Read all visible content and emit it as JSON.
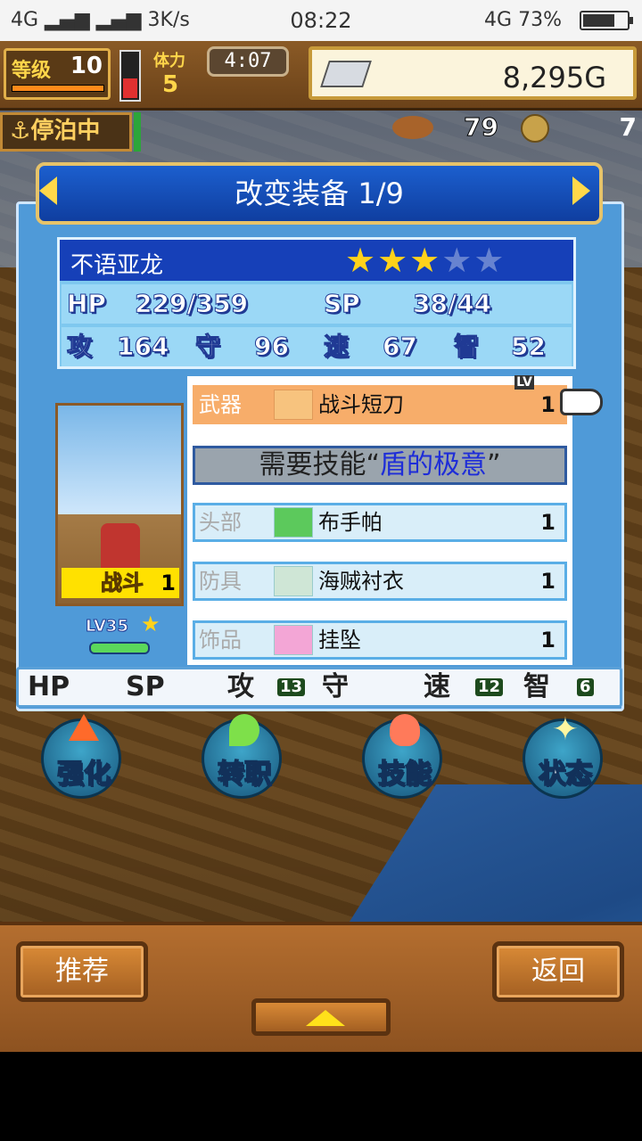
{
  "status_bar": {
    "network": "4G",
    "speed": "3K/s",
    "time": "08:22",
    "battery_network": "4G",
    "battery_pct": "73%",
    "battery_level": 0.73
  },
  "hud": {
    "level_label": "等级",
    "level_value": "10",
    "stamina_label": "体力",
    "stamina_value": "5",
    "timer": "4:07",
    "gold": "8,295G",
    "moored_label": "停泊中",
    "res_a": "79",
    "res_b": "7"
  },
  "panel": {
    "title": "改变装备 1/9",
    "character": {
      "name": "不语亚龙",
      "stars_filled": 3,
      "stars_total": 5,
      "hp_label": "HP",
      "hp_value": "229/359",
      "sp_label": "SP",
      "sp_value": "38/44",
      "atk_label": "攻",
      "atk_value": "164",
      "def_label": "守",
      "def_value": "96",
      "spd_label": "速",
      "spd_value": "67",
      "int_label": "智",
      "int_value": "52",
      "job_badge": "战斗",
      "job_level": "1",
      "level_tag": "LV35"
    },
    "equipment": [
      {
        "slot": "武器",
        "name": "战斗短刀",
        "lv": "1",
        "selected": true
      },
      {
        "slot": "头部",
        "name": "布手帕",
        "lv": "1",
        "selected": false
      },
      {
        "slot": "防具",
        "name": "海贼衬衣",
        "lv": "1",
        "selected": false
      },
      {
        "slot": "饰品",
        "name": "挂坠",
        "lv": "1",
        "selected": false
      }
    ],
    "lv_tag": "LV",
    "skill_req_prefix": "需要技能“",
    "skill_req_name": "盾的极意",
    "skill_req_suffix": "”",
    "bonus_strip": {
      "hp_label": "HP",
      "sp_label": "SP",
      "atk_label": "攻",
      "atk_bonus": "13",
      "def_label": "守",
      "spd_label": "速",
      "spd_bonus": "12",
      "int_label": "智",
      "int_bonus": "6"
    }
  },
  "actions": [
    {
      "label": "强化",
      "icon": "up-arrow-icon"
    },
    {
      "label": "转职",
      "icon": "leaf-icon"
    },
    {
      "label": "技能",
      "icon": "flame-icon"
    },
    {
      "label": "状态",
      "icon": "sparkle-icon"
    }
  ],
  "bottom": {
    "recommend_label": "推荐",
    "back_label": "返回"
  },
  "colors": {
    "panel_blue": "#4f9ad8",
    "title_blue": "#1640b8",
    "selected_row": "#f7ad6a",
    "gold_border": "#e6c36a"
  }
}
